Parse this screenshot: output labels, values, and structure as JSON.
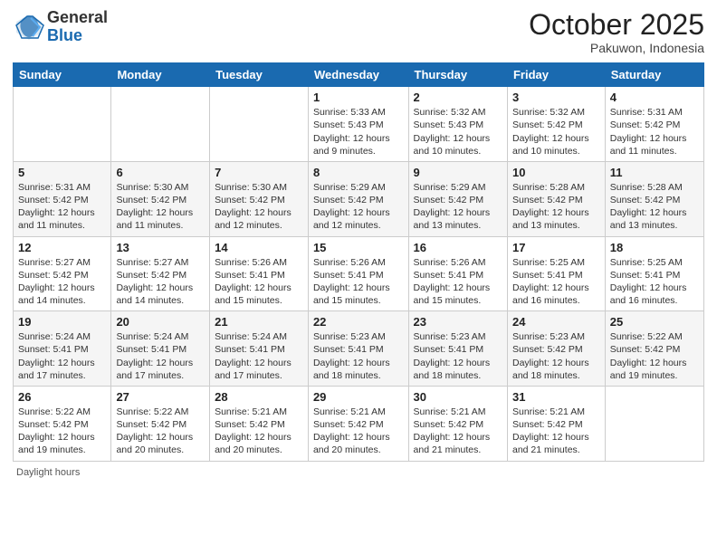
{
  "header": {
    "logo_general": "General",
    "logo_blue": "Blue",
    "month": "October 2025",
    "location": "Pakuwon, Indonesia"
  },
  "days_of_week": [
    "Sunday",
    "Monday",
    "Tuesday",
    "Wednesday",
    "Thursday",
    "Friday",
    "Saturday"
  ],
  "weeks": [
    [
      {
        "day": "",
        "info": ""
      },
      {
        "day": "",
        "info": ""
      },
      {
        "day": "",
        "info": ""
      },
      {
        "day": "1",
        "info": "Sunrise: 5:33 AM\nSunset: 5:43 PM\nDaylight: 12 hours and 9 minutes."
      },
      {
        "day": "2",
        "info": "Sunrise: 5:32 AM\nSunset: 5:43 PM\nDaylight: 12 hours and 10 minutes."
      },
      {
        "day": "3",
        "info": "Sunrise: 5:32 AM\nSunset: 5:42 PM\nDaylight: 12 hours and 10 minutes."
      },
      {
        "day": "4",
        "info": "Sunrise: 5:31 AM\nSunset: 5:42 PM\nDaylight: 12 hours and 11 minutes."
      }
    ],
    [
      {
        "day": "5",
        "info": "Sunrise: 5:31 AM\nSunset: 5:42 PM\nDaylight: 12 hours and 11 minutes."
      },
      {
        "day": "6",
        "info": "Sunrise: 5:30 AM\nSunset: 5:42 PM\nDaylight: 12 hours and 11 minutes."
      },
      {
        "day": "7",
        "info": "Sunrise: 5:30 AM\nSunset: 5:42 PM\nDaylight: 12 hours and 12 minutes."
      },
      {
        "day": "8",
        "info": "Sunrise: 5:29 AM\nSunset: 5:42 PM\nDaylight: 12 hours and 12 minutes."
      },
      {
        "day": "9",
        "info": "Sunrise: 5:29 AM\nSunset: 5:42 PM\nDaylight: 12 hours and 13 minutes."
      },
      {
        "day": "10",
        "info": "Sunrise: 5:28 AM\nSunset: 5:42 PM\nDaylight: 12 hours and 13 minutes."
      },
      {
        "day": "11",
        "info": "Sunrise: 5:28 AM\nSunset: 5:42 PM\nDaylight: 12 hours and 13 minutes."
      }
    ],
    [
      {
        "day": "12",
        "info": "Sunrise: 5:27 AM\nSunset: 5:42 PM\nDaylight: 12 hours and 14 minutes."
      },
      {
        "day": "13",
        "info": "Sunrise: 5:27 AM\nSunset: 5:42 PM\nDaylight: 12 hours and 14 minutes."
      },
      {
        "day": "14",
        "info": "Sunrise: 5:26 AM\nSunset: 5:41 PM\nDaylight: 12 hours and 15 minutes."
      },
      {
        "day": "15",
        "info": "Sunrise: 5:26 AM\nSunset: 5:41 PM\nDaylight: 12 hours and 15 minutes."
      },
      {
        "day": "16",
        "info": "Sunrise: 5:26 AM\nSunset: 5:41 PM\nDaylight: 12 hours and 15 minutes."
      },
      {
        "day": "17",
        "info": "Sunrise: 5:25 AM\nSunset: 5:41 PM\nDaylight: 12 hours and 16 minutes."
      },
      {
        "day": "18",
        "info": "Sunrise: 5:25 AM\nSunset: 5:41 PM\nDaylight: 12 hours and 16 minutes."
      }
    ],
    [
      {
        "day": "19",
        "info": "Sunrise: 5:24 AM\nSunset: 5:41 PM\nDaylight: 12 hours and 17 minutes."
      },
      {
        "day": "20",
        "info": "Sunrise: 5:24 AM\nSunset: 5:41 PM\nDaylight: 12 hours and 17 minutes."
      },
      {
        "day": "21",
        "info": "Sunrise: 5:24 AM\nSunset: 5:41 PM\nDaylight: 12 hours and 17 minutes."
      },
      {
        "day": "22",
        "info": "Sunrise: 5:23 AM\nSunset: 5:41 PM\nDaylight: 12 hours and 18 minutes."
      },
      {
        "day": "23",
        "info": "Sunrise: 5:23 AM\nSunset: 5:41 PM\nDaylight: 12 hours and 18 minutes."
      },
      {
        "day": "24",
        "info": "Sunrise: 5:23 AM\nSunset: 5:42 PM\nDaylight: 12 hours and 18 minutes."
      },
      {
        "day": "25",
        "info": "Sunrise: 5:22 AM\nSunset: 5:42 PM\nDaylight: 12 hours and 19 minutes."
      }
    ],
    [
      {
        "day": "26",
        "info": "Sunrise: 5:22 AM\nSunset: 5:42 PM\nDaylight: 12 hours and 19 minutes."
      },
      {
        "day": "27",
        "info": "Sunrise: 5:22 AM\nSunset: 5:42 PM\nDaylight: 12 hours and 20 minutes."
      },
      {
        "day": "28",
        "info": "Sunrise: 5:21 AM\nSunset: 5:42 PM\nDaylight: 12 hours and 20 minutes."
      },
      {
        "day": "29",
        "info": "Sunrise: 5:21 AM\nSunset: 5:42 PM\nDaylight: 12 hours and 20 minutes."
      },
      {
        "day": "30",
        "info": "Sunrise: 5:21 AM\nSunset: 5:42 PM\nDaylight: 12 hours and 21 minutes."
      },
      {
        "day": "31",
        "info": "Sunrise: 5:21 AM\nSunset: 5:42 PM\nDaylight: 12 hours and 21 minutes."
      },
      {
        "day": "",
        "info": ""
      }
    ]
  ],
  "footer": {
    "daylight_label": "Daylight hours"
  }
}
